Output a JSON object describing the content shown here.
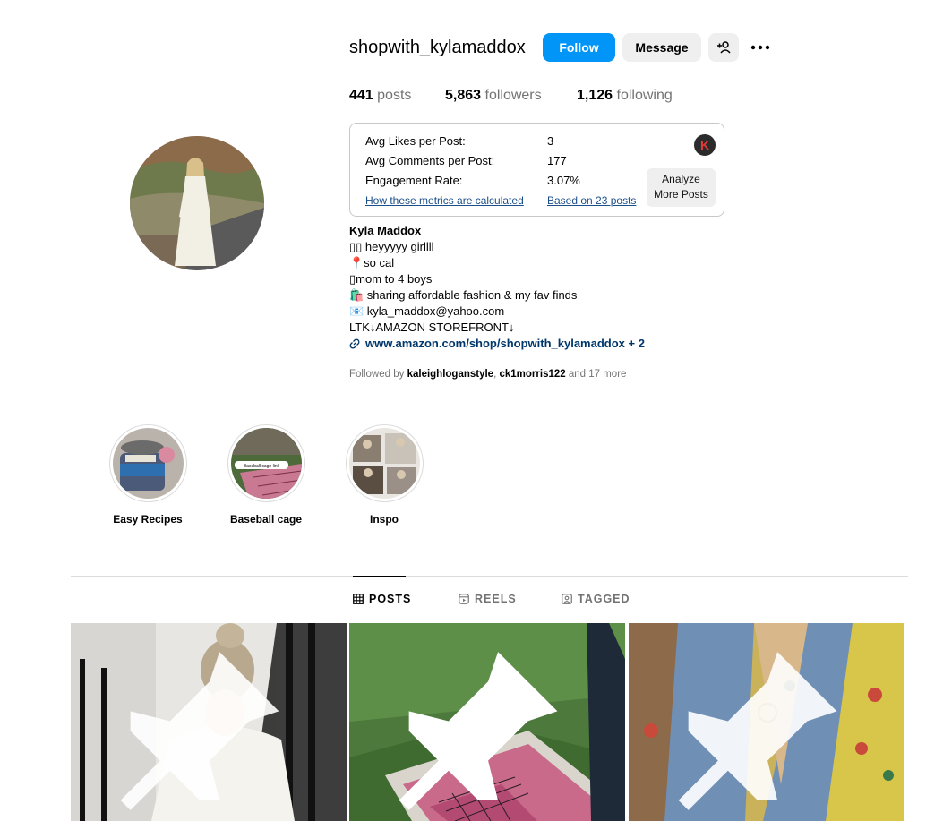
{
  "profile": {
    "username": "shopwith_kylamaddox",
    "follow_label": "Follow",
    "message_label": "Message",
    "stats": {
      "posts_count": "441",
      "posts_label": "posts",
      "followers_count": "5,863",
      "followers_label": "followers",
      "following_count": "1,126",
      "following_label": "following"
    }
  },
  "metrics": {
    "avg_likes_label": "Avg Likes per Post:",
    "avg_likes_value": "3",
    "avg_comments_label": "Avg Comments per Post:",
    "avg_comments_value": "177",
    "engagement_label": "Engagement Rate:",
    "engagement_value": "3.07%",
    "how_link": "How these metrics are calculated",
    "based_link": "Based on 23 posts",
    "logo_letter": "K",
    "analyze_line1": "Analyze",
    "analyze_line2": "More Posts"
  },
  "bio": {
    "name": "Kyla Maddox",
    "line1": "▯▯ heyyyyy girllll",
    "line2": "📍so cal",
    "line3": "▯mom to 4 boys",
    "line4": "🛍️ sharing affordable fashion & my fav finds",
    "line5": "📧 kyla_maddox@yahoo.com",
    "line6": "LTK↓AMAZON STOREFRONT↓",
    "link": "www.amazon.com/shop/shopwith_kylamaddox + 2"
  },
  "followed_by": {
    "prefix": "Followed by",
    "user1": "kaleighloganstyle",
    "user2": "ck1morris122",
    "suffix": "and 17 more"
  },
  "highlights": [
    {
      "label": "Easy Recipes"
    },
    {
      "label": "Baseball cage"
    },
    {
      "label": "Inspo"
    }
  ],
  "highlight_sticker_text": "Baseball cage link",
  "tabs": {
    "posts": "POSTS",
    "reels": "REELS",
    "tagged": "TAGGED"
  },
  "colors": {
    "follow_blue": "#0095f6",
    "link_blue": "#00376b",
    "metrics_link": "#1b4f8a"
  }
}
